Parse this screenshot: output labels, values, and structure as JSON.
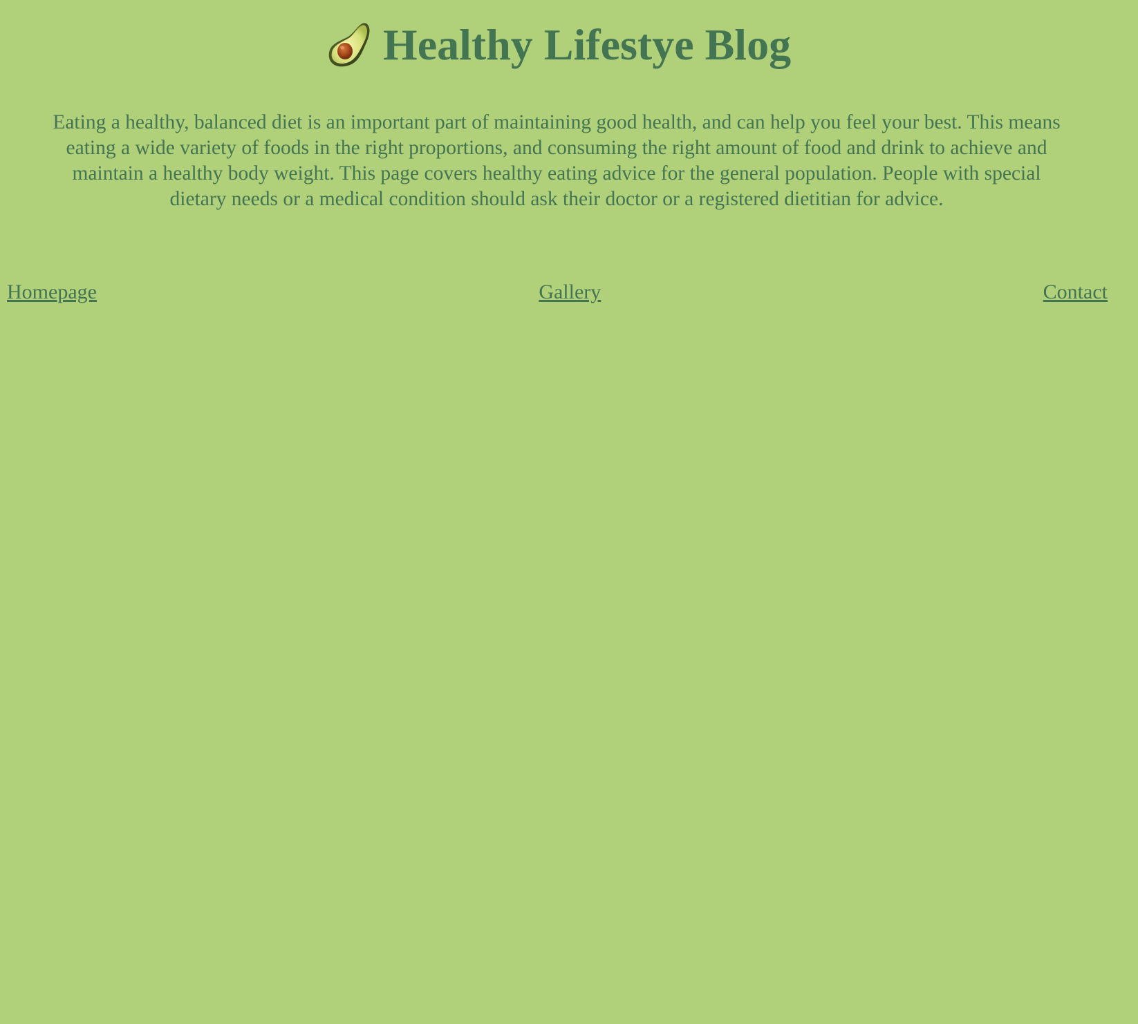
{
  "header": {
    "icon": "avocado-icon",
    "title": "Healthy Lifestye Blog"
  },
  "intro": {
    "text": "Eating a healthy, balanced diet is an important part of maintaining good health, and can help you feel your best. This means eating a wide variety of foods in the right proportions, and consuming the right amount of food and drink to achieve and maintain a healthy body weight. This page covers healthy eating advice for the general population. People with special dietary needs or a medical condition should ask their doctor or a registered dietitian for advice."
  },
  "nav": {
    "items": [
      {
        "label": "Homepage"
      },
      {
        "label": "Gallery"
      },
      {
        "label": "Contact"
      }
    ]
  },
  "colors": {
    "background": "#b1d07a",
    "text": "#447552"
  }
}
